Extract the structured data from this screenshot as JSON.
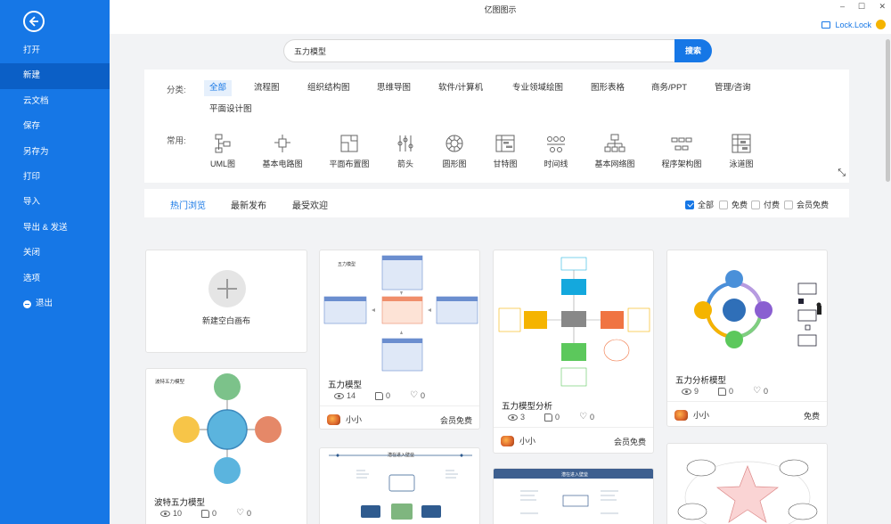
{
  "app": {
    "title": "亿图图示"
  },
  "window": {
    "minimize": "–",
    "maximize": "☐",
    "close": "✕"
  },
  "user": {
    "name": "Lock.Lock"
  },
  "sidebar": {
    "items": [
      {
        "label": "打开"
      },
      {
        "label": "新建"
      },
      {
        "label": "云文档"
      },
      {
        "label": "保存"
      },
      {
        "label": "另存为"
      },
      {
        "label": "打印"
      },
      {
        "label": "导入"
      },
      {
        "label": "导出 & 发送"
      },
      {
        "label": "关闭"
      },
      {
        "label": "选项"
      },
      {
        "label": "退出"
      }
    ]
  },
  "search": {
    "value": "五力模型",
    "button": "搜索"
  },
  "filter": {
    "category_label": "分类:",
    "categories": [
      "全部",
      "流程图",
      "组织结构图",
      "思维导图",
      "软件/计算机",
      "专业领域绘图",
      "图形表格",
      "商务/PPT",
      "管理/咨询",
      "平面设计图"
    ],
    "common_label": "常用:",
    "tools": [
      "UML图",
      "基本电路图",
      "平面布置图",
      "箭头",
      "圆形图",
      "甘特图",
      "时间线",
      "基本网络图",
      "程序架构图",
      "泳道图"
    ]
  },
  "tabs": {
    "items": [
      "热门浏览",
      "最新发布",
      "最受欢迎"
    ]
  },
  "price_filters": [
    "全部",
    "免费",
    "付费",
    "会员免费"
  ],
  "new_canvas": {
    "label": "新建空白画布"
  },
  "cards": [
    {
      "title": "五力模型",
      "views": "14",
      "likes": "0",
      "favs": "0",
      "author": "小小",
      "badge": "会员免费",
      "thumb_title": "五力模型"
    },
    {
      "title": "五力模型分析",
      "views": "3",
      "likes": "0",
      "favs": "0",
      "author": "小小",
      "badge": "会员免费"
    },
    {
      "title": "五力分析模型",
      "views": "9",
      "likes": "0",
      "favs": "0",
      "author": "小小",
      "badge": "免费"
    },
    {
      "title": "波特五力模型",
      "views": "10",
      "likes": "0",
      "favs": "0",
      "thumb_title": "波特五力模型"
    }
  ],
  "partial_cards": [
    {
      "thumb_title": "潜在进入壁垒"
    },
    {
      "thumb_title": "潜在进入壁垒"
    }
  ],
  "colors": {
    "accent": "#1677e6",
    "sidebar": "#1677e6",
    "sidebar_active": "#0b5fc6"
  }
}
